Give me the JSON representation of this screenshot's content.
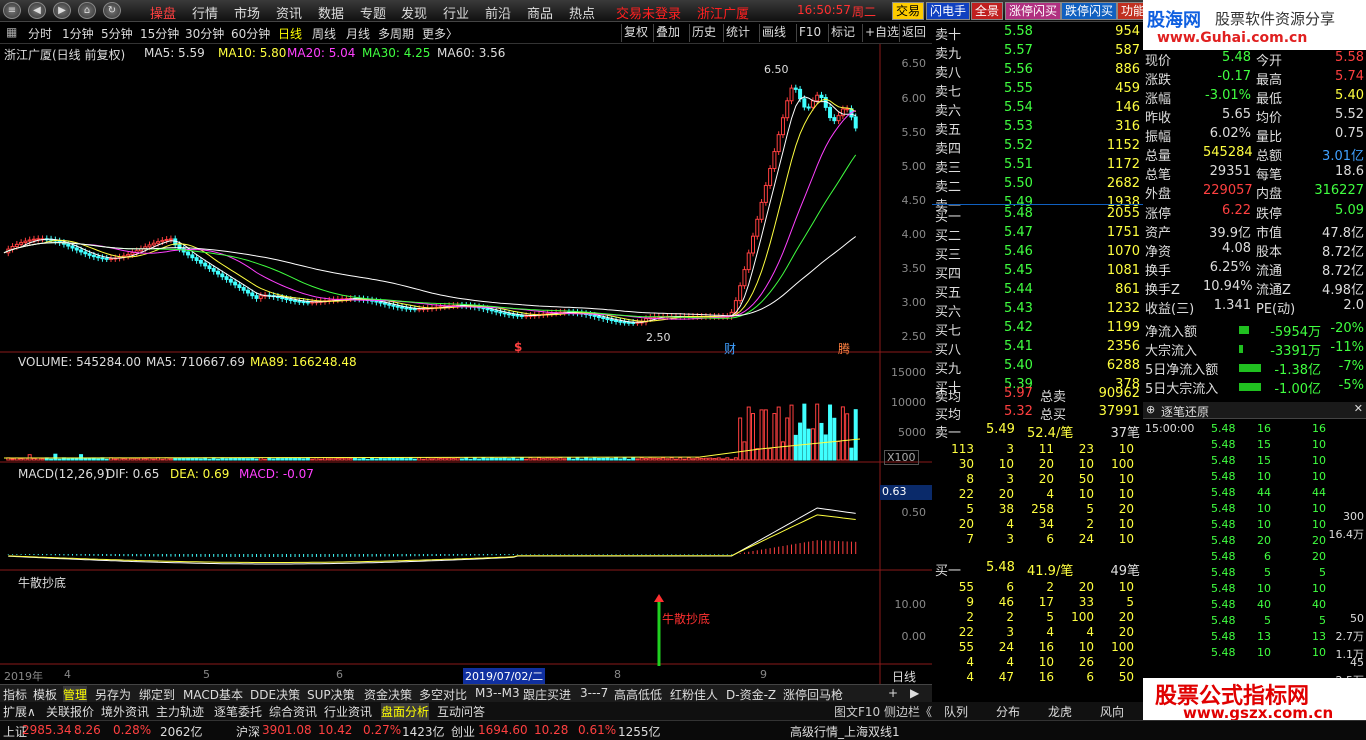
{
  "menu": {
    "items": [
      "操盘",
      "行情",
      "市场",
      "资讯",
      "数据",
      "专题",
      "发现",
      "行业",
      "前沿",
      "商品",
      "热点"
    ],
    "status": "交易未登录",
    "stock_name": "浙江广厦",
    "time": "16:50:57",
    "weekday": "周二",
    "buttons": [
      "交易",
      "闪电手",
      "全景",
      "涨停闪买",
      "跌停闪买",
      "功能"
    ]
  },
  "periods": [
    "分时",
    "1分钟",
    "5分钟",
    "15分钟",
    "30分钟",
    "60分钟",
    "日线",
    "周线",
    "月线",
    "多周期",
    "更多〉"
  ],
  "toolbar_buttons": [
    "复权",
    "叠加",
    "历史",
    "统计",
    "画线",
    "F10",
    "标记",
    "+自选",
    "返回"
  ],
  "main_chart": {
    "title": "浙江广厦(日线 前复权)",
    "ma5": "MA5: 5.59",
    "ma10": "MA10: 5.80",
    "ma20": "MA20: 5.04",
    "ma30": "MA30: 4.25",
    "ma60": "MA60: 3.56",
    "high_label": "6.50",
    "low_label": "2.50",
    "axis": [
      "6.50",
      "6.00",
      "5.50",
      "5.00",
      "4.50",
      "4.00",
      "3.50",
      "3.00",
      "2.50"
    ],
    "marks": [
      "$",
      "财",
      "腾"
    ]
  },
  "volume": {
    "title": "VOLUME: 545284.00",
    "ma5": "MA5: 710667.69",
    "ma89": "MA89: 166248.48",
    "axis": [
      "15000",
      "10000",
      "5000"
    ],
    "unit": "X100"
  },
  "macd": {
    "title": "MACD(12,26,9)",
    "dif": "DIF: 0.65",
    "dea": "DEA: 0.69",
    "macd": "MACD: -0.07",
    "axis_value": "0.63",
    "axis": [
      "0.50"
    ]
  },
  "signal": {
    "title": "牛散抄底",
    "label": "牛散抄底",
    "axis": [
      "10.00",
      "0.00"
    ]
  },
  "xaxis": {
    "labels": [
      "2019年",
      "4",
      "5",
      "6",
      "7",
      "8",
      "9"
    ],
    "cursor": "2019/07/02/二",
    "period": "日线"
  },
  "bottom_tabs": [
    "指标",
    "模板",
    "管理",
    "另存为",
    "绑定到",
    "MACD基本",
    "DDE决策",
    "SUP决策",
    "资金决策",
    "多空对比",
    "M3--M3",
    "跟庄买进",
    "3---7",
    "高高低低",
    "红粉佳人",
    "D-资金-Z",
    "涨停回马枪"
  ],
  "ext_tabs": [
    "扩展∧",
    "关联报价",
    "境外资讯",
    "主力轨迹",
    "逐笔委托",
    "综合资讯",
    "行业资讯",
    "盘面分析",
    "互动问答"
  ],
  "ext_right": "图文F10 侧边栏《",
  "orderbook": {
    "asks": [
      [
        "卖十",
        "5.58",
        "954"
      ],
      [
        "卖九",
        "5.57",
        "587"
      ],
      [
        "卖八",
        "5.56",
        "886"
      ],
      [
        "卖七",
        "5.55",
        "459"
      ],
      [
        "卖六",
        "5.54",
        "146"
      ],
      [
        "卖五",
        "5.53",
        "316"
      ],
      [
        "卖四",
        "5.52",
        "1152"
      ],
      [
        "卖三",
        "5.51",
        "1172"
      ],
      [
        "卖二",
        "5.50",
        "2682"
      ],
      [
        "卖一",
        "5.49",
        "1938"
      ]
    ],
    "bids": [
      [
        "买一",
        "5.48",
        "2055"
      ],
      [
        "买二",
        "5.47",
        "1751"
      ],
      [
        "买三",
        "5.46",
        "1070"
      ],
      [
        "买四",
        "5.45",
        "1081"
      ],
      [
        "买五",
        "5.44",
        "861"
      ],
      [
        "买六",
        "5.43",
        "1232"
      ],
      [
        "买七",
        "5.42",
        "1199"
      ],
      [
        "买八",
        "5.41",
        "2356"
      ],
      [
        "买九",
        "5.40",
        "6288"
      ],
      [
        "买十",
        "5.39",
        "378"
      ]
    ],
    "ask_avg": [
      "卖均",
      "5.97",
      "总卖",
      "90962"
    ],
    "bid_avg": [
      "买均",
      "5.32",
      "总买",
      "37991"
    ]
  },
  "info": [
    [
      "现价",
      "5.48",
      "今开",
      "5.58"
    ],
    [
      "涨跌",
      "-0.17",
      "最高",
      "5.74"
    ],
    [
      "涨幅",
      "-3.01%",
      "最低",
      "5.40"
    ],
    [
      "昨收",
      "5.65",
      "均价",
      "5.52"
    ],
    [
      "振幅",
      "6.02%",
      "量比",
      "0.75"
    ],
    [
      "总量",
      "545284",
      "总额",
      "3.01亿"
    ],
    [
      "总笔",
      "29351",
      "每笔",
      "18.6"
    ],
    [
      "外盘",
      "229057",
      "内盘",
      "316227"
    ],
    [
      "涨停",
      "6.22",
      "跌停",
      "5.09"
    ],
    [
      "资产",
      "39.9亿",
      "市值",
      "47.8亿"
    ],
    [
      "净资",
      "4.08",
      "股本",
      "8.72亿"
    ],
    [
      "换手",
      "6.25%",
      "流通",
      "8.72亿"
    ],
    [
      "换手Z",
      "10.94%",
      "流通Z",
      "4.98亿"
    ],
    [
      "收益(三)",
      "1.341",
      "PE(动)",
      "2.0"
    ]
  ],
  "flows": [
    [
      "净流入额",
      "-5954万",
      "-20%"
    ],
    [
      "大宗流入",
      "-3391万",
      "-11%"
    ],
    [
      "5日净流入额",
      "-1.38亿",
      "-7%"
    ],
    [
      "5日大宗流入",
      "-1.00亿",
      "-5%"
    ]
  ],
  "logo": {
    "name": "股海网",
    "slogan": "股票软件资源分享",
    "url": "www.Guhai.com.cn"
  },
  "sell_queue": {
    "label": "卖一",
    "price": "5.49",
    "info": "52.4/笔",
    "count": "37笔",
    "rows": [
      [
        "113",
        "3",
        "11",
        "23",
        "10"
      ],
      [
        "30",
        "10",
        "20",
        "10",
        "100"
      ],
      [
        "8",
        "3",
        "20",
        "50",
        "10"
      ],
      [
        "22",
        "20",
        "4",
        "10",
        "10"
      ],
      [
        "5",
        "38",
        "258",
        "5",
        "20"
      ],
      [
        "20",
        "4",
        "34",
        "2",
        "10"
      ],
      [
        "7",
        "3",
        "6",
        "24",
        "10"
      ]
    ]
  },
  "buy_queue": {
    "label": "买一",
    "price": "5.48",
    "info": "41.9/笔",
    "count": "49笔",
    "rows": [
      [
        "55",
        "6",
        "2",
        "20",
        "10"
      ],
      [
        "9",
        "46",
        "17",
        "33",
        "5"
      ],
      [
        "2",
        "2",
        "5",
        "100",
        "20"
      ],
      [
        "22",
        "3",
        "4",
        "4",
        "20"
      ],
      [
        "55",
        "24",
        "16",
        "10",
        "100"
      ],
      [
        "4",
        "4",
        "10",
        "26",
        "20"
      ],
      [
        "4",
        "47",
        "16",
        "6",
        "50"
      ]
    ]
  },
  "tick_title": "逐笔还原",
  "ticks": [
    [
      "15:00:00",
      "5.48",
      "16",
      "16"
    ],
    [
      "",
      "5.48",
      "15",
      "10"
    ],
    [
      "",
      "5.48",
      "15",
      "10"
    ],
    [
      "",
      "5.48",
      "10",
      "10"
    ],
    [
      "",
      "5.48",
      "44",
      "44"
    ],
    [
      "",
      "5.48",
      "10",
      "10"
    ],
    [
      "",
      "5.48",
      "10",
      "10"
    ],
    [
      "",
      "5.48",
      "20",
      "20"
    ],
    [
      "",
      "5.48",
      "6",
      "20"
    ],
    [
      "",
      "5.48",
      "5",
      "5"
    ],
    [
      "",
      "5.48",
      "10",
      "10"
    ],
    [
      "",
      "5.48",
      "40",
      "40"
    ],
    [
      "",
      "5.48",
      "5",
      "5"
    ],
    [
      "",
      "5.48",
      "13",
      "13"
    ],
    [
      "",
      "5.48",
      "10",
      "10"
    ]
  ],
  "ticks_side": [
    "300",
    "16.4万",
    "50",
    "2.7万",
    "45",
    "1.1万",
    "2.5万"
  ],
  "right_tabs": [
    "队列",
    "分布",
    "龙虎",
    "风向"
  ],
  "banner": {
    "title": "股票公式指标网",
    "url": "www.gszx.com.cn"
  },
  "ticker": [
    [
      "上证",
      "2985.34",
      "8.26",
      "0.28%",
      "2062亿"
    ],
    [
      "沪深",
      "3901.08",
      "10.42",
      "0.27%",
      "1423亿"
    ],
    [
      "创业",
      "1694.60",
      "10.28",
      "0.61%",
      "1255亿"
    ]
  ],
  "ticker_right": "高级行情_上海双线1"
}
